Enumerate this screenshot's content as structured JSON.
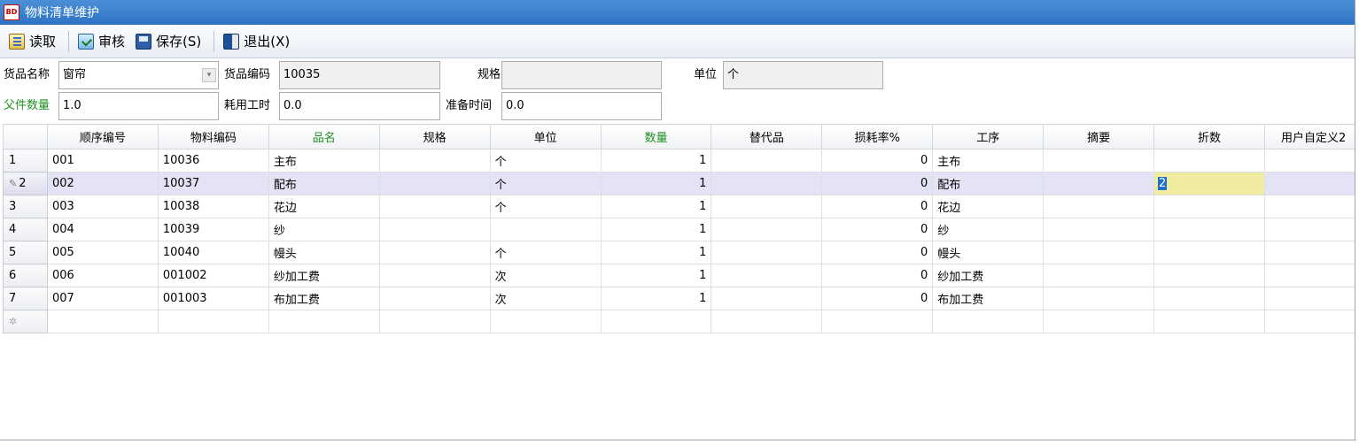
{
  "window": {
    "title": "物料清单维护",
    "app_badge": "BD"
  },
  "toolbar": {
    "read_label": "读取",
    "audit_label": "审核",
    "save_label": "保存(S)",
    "exit_label": "退出(X)"
  },
  "form": {
    "product_name_label": "货品名称",
    "product_name_value": "窗帘",
    "product_code_label": "货品编码",
    "product_code_value": "10035",
    "spec_label": "规格",
    "spec_value": "",
    "unit_label": "单位",
    "unit_value": "个",
    "parent_qty_label": "父件数量",
    "parent_qty_value": "1.0",
    "work_hours_label": "耗用工时",
    "work_hours_value": "0.0",
    "prep_time_label": "准备时间",
    "prep_time_value": "0.0"
  },
  "grid": {
    "columns": [
      "顺序编号",
      "物料编码",
      "品名",
      "规格",
      "单位",
      "数量",
      "替代品",
      "损耗率%",
      "工序",
      "摘要",
      "折数",
      "用户自定义2"
    ],
    "rows": [
      {
        "row_no": "1",
        "seq": "001",
        "code": "10036",
        "name": "主布",
        "spec": "",
        "unit": "个",
        "qty": "1",
        "sub": "",
        "loss": "0",
        "process": "主布",
        "summary": "",
        "fold": "",
        "custom2": ""
      },
      {
        "row_no": "2",
        "seq": "002",
        "code": "10037",
        "name": "配布",
        "spec": "",
        "unit": "个",
        "qty": "1",
        "sub": "",
        "loss": "0",
        "process": "配布",
        "summary": "",
        "fold": "2",
        "custom2": ""
      },
      {
        "row_no": "3",
        "seq": "003",
        "code": "10038",
        "name": "花边",
        "spec": "",
        "unit": "个",
        "qty": "1",
        "sub": "",
        "loss": "0",
        "process": "花边",
        "summary": "",
        "fold": "",
        "custom2": ""
      },
      {
        "row_no": "4",
        "seq": "004",
        "code": "10039",
        "name": "纱",
        "spec": "",
        "unit": "",
        "qty": "1",
        "sub": "",
        "loss": "0",
        "process": "纱",
        "summary": "",
        "fold": "",
        "custom2": ""
      },
      {
        "row_no": "5",
        "seq": "005",
        "code": "10040",
        "name": "幔头",
        "spec": "",
        "unit": "个",
        "qty": "1",
        "sub": "",
        "loss": "0",
        "process": "幔头",
        "summary": "",
        "fold": "",
        "custom2": ""
      },
      {
        "row_no": "6",
        "seq": "006",
        "code": "001002",
        "name": "纱加工费",
        "spec": "",
        "unit": "次",
        "qty": "1",
        "sub": "",
        "loss": "0",
        "process": "纱加工费",
        "summary": "",
        "fold": "",
        "custom2": ""
      },
      {
        "row_no": "7",
        "seq": "007",
        "code": "001003",
        "name": "布加工费",
        "spec": "",
        "unit": "次",
        "qty": "1",
        "sub": "",
        "loss": "0",
        "process": "布加工费",
        "summary": "",
        "fold": "",
        "custom2": ""
      }
    ],
    "active_row": 1,
    "editing_column": "fold"
  },
  "icons": {
    "read": "read-document-icon",
    "audit": "audit-check-icon",
    "save": "floppy-disk-icon",
    "exit": "exit-door-icon",
    "row_edit": "pencil-icon",
    "new_row": "new-row-star-icon",
    "combo": "chevron-down-icon"
  },
  "colors": {
    "title_bar": "#2f74c4",
    "required_label": "#1f8f1f",
    "active_row": "#e3e3f5",
    "editing_cell": "#f0ec9f",
    "selection": "#1f6fd0"
  }
}
